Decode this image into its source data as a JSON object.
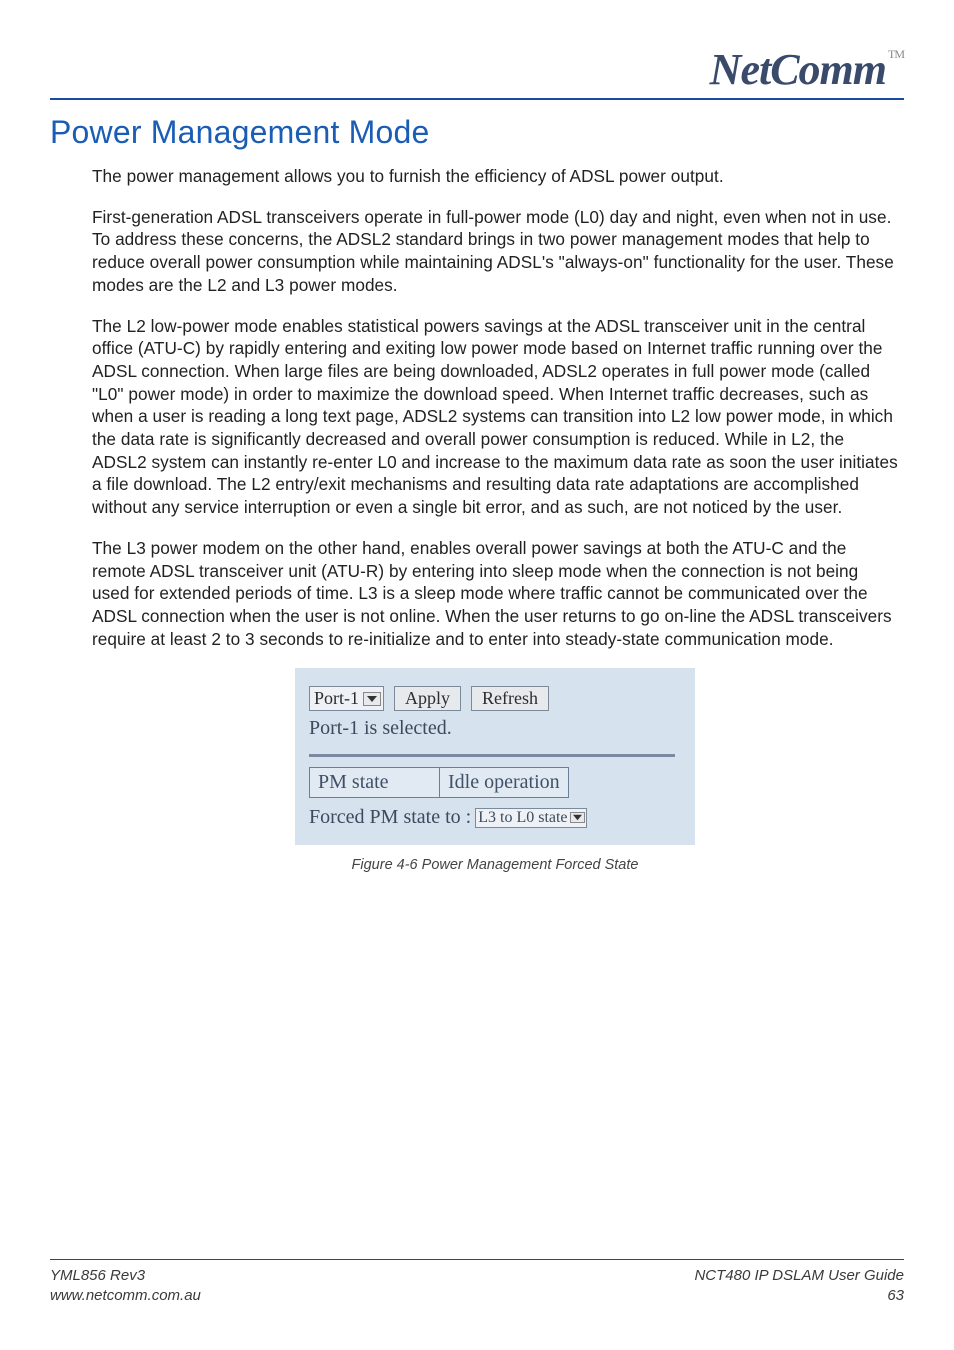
{
  "brand": {
    "name": "NetComm",
    "tm": "TM"
  },
  "heading": "Power Management Mode",
  "paragraphs": [
    "The power management allows you to furnish the efficiency of ADSL power output.",
    "First-generation ADSL transceivers operate in full-power mode (L0) day and night, even when not in use. To address these concerns, the ADSL2 standard brings in two power management modes that help to reduce overall power consumption while maintaining ADSL's \"always-on\" functionality for the user. These modes are the L2 and L3 power modes.",
    "The L2 low-power mode enables statistical powers savings at the ADSL transceiver unit in the central office (ATU-C) by rapidly entering and exiting low power mode based on Internet traffic running over the ADSL connection. When large files are being downloaded, ADSL2 operates in full power mode (called \"L0\" power mode) in order to maximize the download speed. When Internet traffic decreases, such as when a user is reading a long text page, ADSL2 systems can transition into L2 low power mode, in which the data rate is significantly decreased and overall power consumption is reduced. While in L2, the ADSL2 system can instantly re-enter L0 and increase to the maximum data rate as soon the user initiates a file download. The L2 entry/exit mechanisms and resulting data rate adaptations are accomplished without any service interruption or even a single bit error, and as such, are not noticed by the user.",
    " The L3 power modem on the other hand, enables overall power savings at both the ATU-C and the remote ADSL transceiver unit (ATU-R) by entering into sleep mode when the connection is not being used for extended periods of time. L3 is a sleep mode where traffic cannot be communicated over the ADSL connection when the user is not online. When the user returns to go on-line the ADSL transceivers require at least 2 to 3 seconds to re-initialize and to enter into steady-state communication mode."
  ],
  "figure": {
    "port_select": "Port-1",
    "apply_label": "Apply",
    "refresh_label": "Refresh",
    "status": "Port-1 is selected.",
    "table": {
      "label": "PM state",
      "value": "Idle operation"
    },
    "forced_label": "Forced PM state to :",
    "forced_value": "L3 to L0 state",
    "caption": "Figure 4-6 Power Management Forced State"
  },
  "footer": {
    "left1": "YML856 Rev3",
    "left2": "www.netcomm.com.au",
    "right1": "NCT480 IP DSLAM User Guide",
    "right2": "63"
  }
}
